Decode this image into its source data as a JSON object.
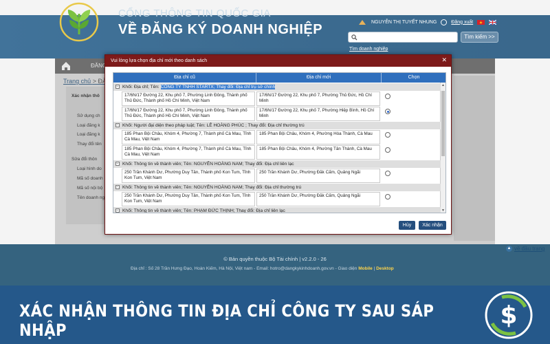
{
  "header": {
    "title_line1": "CỔNG THÔNG TIN QUỐC GIA",
    "title_line2": "VỀ ĐĂNG KÝ DOANH NGHIỆP",
    "user_name": "NGUYỄN THỊ TUYẾT NHUNG",
    "logout": "Đăng xuất",
    "search_button": "Tìm kiếm >>",
    "advanced_search": "Tìm doanh nghiệp"
  },
  "nav": {
    "item": "ĐĂNG"
  },
  "breadcrumb": {
    "home": "Trang chủ",
    "rest": "> ĐĂ"
  },
  "left_panel": [
    "Xác nhận thô",
    "Sử dụng ch",
    "Loại đăng k",
    "Loại đăng k",
    "Thay đổi tên",
    "Sửa đổi thôn",
    "Loại hình do",
    "Mã số doanh",
    "Mã số nội bộ",
    "Tên doanh ng"
  ],
  "dialog": {
    "title": "Vui lòng lựa chọn địa chỉ mới theo danh sách",
    "close": "✕",
    "columns": [
      "Địa chỉ cũ",
      "Địa chỉ mới",
      "Chọn"
    ],
    "groups": [
      {
        "label_prefix": "Khối: Địa chỉ; Tên: ",
        "label_highlight": "CÔNG TY TNHH STARTX; Thay đổi: Địa chỉ trụ sở chính",
        "rows": [
          {
            "old": "17/6N/17 Đường 22, Khu phố 7, Phường Linh Đông, Thành phố Thủ Đức, Thành phố Hồ Chí Minh, Việt Nam",
            "new": "17/6N/17 Đường 22, Khu phố 7, Phường Thủ Đức, Hồ Chí Minh",
            "selected": false
          },
          {
            "old": "17/6N/17 Đường 22, Khu phố 7, Phường Linh Đông, Thành phố Thủ Đức, Thành phố Hồ Chí Minh, Việt Nam",
            "new": "17/6N/17 Đường 22, Khu phố 7, Phường Hiệp Bình, Hồ Chí Minh",
            "selected": true
          }
        ]
      },
      {
        "label_prefix": "Khối: Người đại diện theo pháp luật; Tên: LÊ HOÀNG PHÚC ; Thay đổi: Địa chỉ thường trú",
        "label_highlight": "",
        "rows": [
          {
            "old": "185 Phan Bội Châu, Khóm 4, Phường 7, Thành phố Cà Mau, Tỉnh Cà Mau, Việt Nam",
            "new": "185 Phan Bội Châu, Khóm 4, Phường Hòa Thành, Cà Mau",
            "selected": false
          },
          {
            "old": "185 Phan Bội Châu, Khóm 4, Phường 7, Thành phố Cà Mau, Tỉnh Cà Mau, Việt Nam",
            "new": "185 Phan Bội Châu, Khóm 4, Phường Tân Thành, Cà Mau",
            "selected": false
          }
        ]
      },
      {
        "label_prefix": "Khối: Thông tin về thành viên; Tên: NGUYỄN HOÀNG NAM; Thay đổi: Địa chỉ liên lạc",
        "label_highlight": "",
        "rows": [
          {
            "old": "250 Trần Khánh Dư, Phường Duy Tân, Thành phố Kon Tum, Tỉnh Kon Tum, Việt Nam",
            "new": "250 Trần Khánh Dư, Phường Đăk Cấm, Quảng Ngãi",
            "selected": false
          }
        ]
      },
      {
        "label_prefix": "Khối: Thông tin về thành viên; Tên: NGUYỄN HOÀNG NAM; Thay đổi: Địa chỉ thường trú",
        "label_highlight": "",
        "rows": [
          {
            "old": "250 Trần Khánh Dư, Phường Duy Tân, Thành phố Kon Tum, Tỉnh Kon Tum, Việt Nam",
            "new": "250 Trần Khánh Dư, Phường Đăk Cấm, Quảng Ngãi",
            "selected": false
          }
        ]
      },
      {
        "label_prefix": "Khối: Thông tin về thành viên; Tên: PHẠM ĐỨC THỊNH; Thay đổi: Địa chỉ liên lạc",
        "label_highlight": "",
        "rows": []
      }
    ],
    "cancel_button": "Hủy",
    "confirm_button": "Xác nhận"
  },
  "footer": {
    "scroll_top": "về đầu trang",
    "copyright": "© Bản quyền thuộc Bộ Tài chính | v2.2.0 - 26",
    "address": "Địa chỉ : Số 28 Trần Hưng Đạo, Hoàn Kiếm, Hà Nội, Việt nam - Email: hotro@dangkykinhdoanh.gov.vn - Giao diện",
    "mobile": "Mobile",
    "desktop": "Desktop"
  },
  "banner": {
    "text": "XÁC NHẬN THÔNG TIN ĐỊA CHỈ CÔNG TY SAU SÁP NHẬP"
  },
  "colors": {
    "header": "#3c6f95",
    "dialog_title": "#7d1a1a",
    "table_header": "#2f6fbd",
    "banner": "#25588a",
    "button": "#254f7e"
  }
}
